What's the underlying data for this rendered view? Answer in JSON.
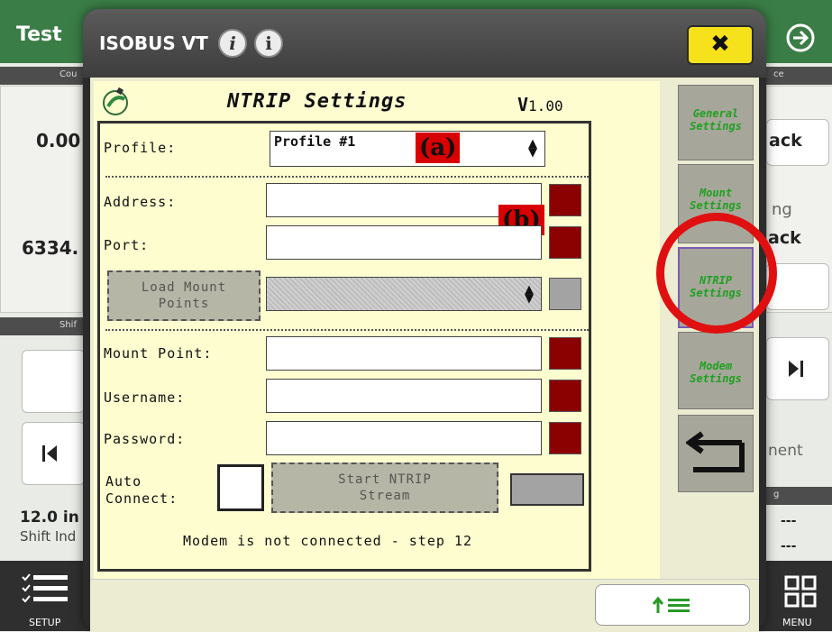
{
  "background_app": {
    "title": "Test",
    "header_left": "Cou",
    "header_right": "ce",
    "value_1": "0.00",
    "value_2": "6334.",
    "track_1": "ack",
    "track_2": "ack",
    "right_word_1": "ng",
    "right_word_2": "nent",
    "shift_strip": "Shif",
    "right_strip": "g",
    "width_value": "12.0 in",
    "shift_label": "Shift Ind",
    "dashes_1": "---",
    "dashes_2": "---",
    "setup_label": "SETUP",
    "menu_label": "MENU"
  },
  "vt": {
    "title": "ISOBUS VT",
    "info_icon_1": "i",
    "info_icon_2": "i",
    "close_symbol": "✖"
  },
  "mask": {
    "title": "NTRIP Settings",
    "version_prefix": "V",
    "version_number": "1.00",
    "callout_a": "(a)",
    "callout_b": "(b)",
    "profile": {
      "label": "Profile:",
      "value": "Profile #1"
    },
    "address": {
      "label": "Address:",
      "value": ""
    },
    "port": {
      "label": "Port:",
      "value": ""
    },
    "load_mount_points": {
      "line1": "Load Mount",
      "line2": "Points"
    },
    "mount_point": {
      "label": "Mount Point:",
      "value": ""
    },
    "username": {
      "label": "Username:",
      "value": ""
    },
    "password": {
      "label": "Password:",
      "value": ""
    },
    "auto_connect": {
      "line1": "Auto",
      "line2": "Connect:"
    },
    "start_stream": {
      "line1": "Start NTRIP",
      "line2": "Stream"
    },
    "status_message": "Modem is not connected - step 12"
  },
  "softkeys": [
    {
      "line1": "General",
      "line2": "Settings"
    },
    {
      "line1": "Mount",
      "line2": "Settings"
    },
    {
      "line1": "NTRIP",
      "line2": "Settings"
    },
    {
      "line1": "Modem",
      "line2": "Settings"
    }
  ],
  "colors": {
    "status_red": "#8b0000",
    "status_grey": "#a3a3a3",
    "softkey_text": "#20a020",
    "close_yellow": "#f6e21a",
    "highlight_ring": "#e01010",
    "mask_background": "#fdfdd0"
  }
}
